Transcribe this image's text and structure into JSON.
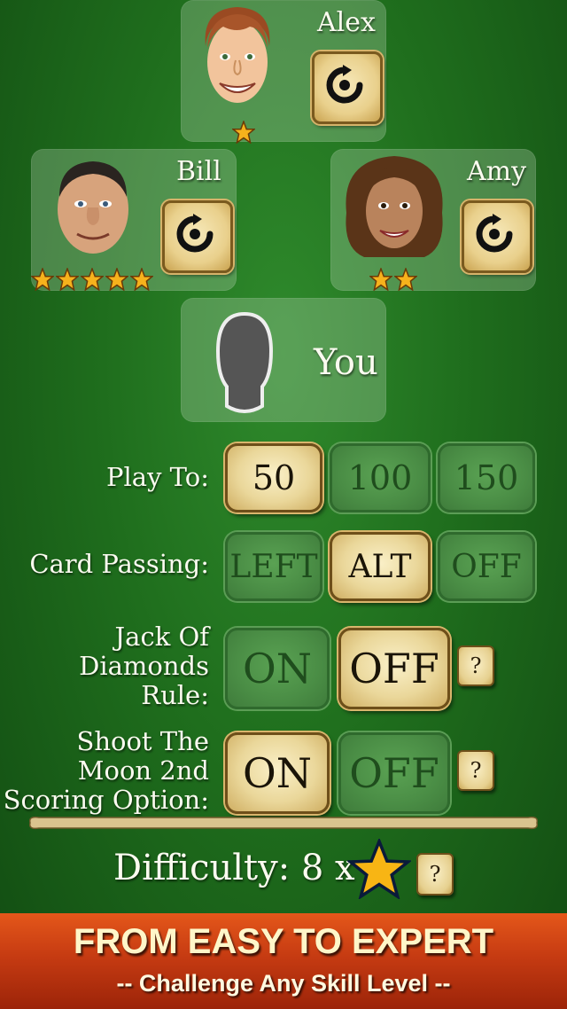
{
  "players": {
    "alex": {
      "name": "Alex",
      "stars": 1
    },
    "bill": {
      "name": "Bill",
      "stars": 5
    },
    "amy": {
      "name": "Amy",
      "stars": 2
    },
    "you": {
      "name": "You"
    }
  },
  "settings": {
    "play_to": {
      "label": "Play To:",
      "options": [
        "50",
        "100",
        "150"
      ],
      "selected": "50"
    },
    "card_passing": {
      "label": "Card Passing:",
      "options": [
        "LEFT",
        "ALT",
        "OFF"
      ],
      "selected": "ALT"
    },
    "jack_of_diamonds": {
      "label_lines": [
        "Jack Of",
        "Diamonds",
        "Rule:"
      ],
      "options": [
        "ON",
        "OFF"
      ],
      "selected": "OFF",
      "help": "?"
    },
    "shoot_the_moon": {
      "label_lines": [
        "Shoot The",
        "Moon 2nd",
        "Scoring Option:"
      ],
      "options": [
        "ON",
        "OFF"
      ],
      "selected": "ON",
      "help": "?"
    }
  },
  "difficulty": {
    "label": "Difficulty: 8 x",
    "help": "?"
  },
  "banner": {
    "title": "FROM EASY TO EXPERT",
    "subtitle": "-- Challenge Any Skill Level --"
  },
  "colors": {
    "felt": "#1f6e1d",
    "gold": "#ead79a",
    "banner": "#c63b12"
  }
}
